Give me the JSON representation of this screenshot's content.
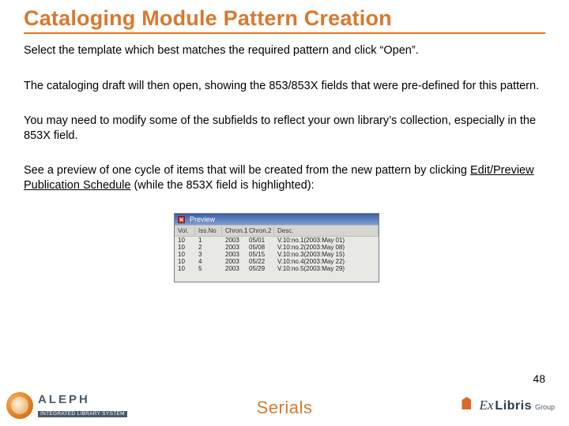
{
  "title": "Cataloging Module Pattern Creation",
  "paragraphs": {
    "p1": "Select the template which best matches the required pattern and click “Open”.",
    "p2": "The cataloging draft will then open, showing the 853/853X fields that were pre-defined for this pattern.",
    "p3": "You may need to modify some of the subfields to reflect your own library’s collection, especially in the 853X field.",
    "p4_a": "See a preview of one cycle of items that will be created from the new pattern by clicking ",
    "p4_link": "Edit/Preview Publication Schedule",
    "p4_b": " (while the 853X field is highlighted):"
  },
  "preview": {
    "title": "Preview",
    "cols": {
      "c1": "Vol.",
      "c2": "Iss.No",
      "c3": "Chron.1",
      "c4": "Chron.2",
      "c5": "Desc."
    },
    "rows": [
      {
        "c1": "10",
        "c2": "1",
        "c3": "2003",
        "c4": "05/01",
        "c5": "V.10:no.1(2003:May 01)"
      },
      {
        "c1": "10",
        "c2": "2",
        "c3": "2003",
        "c4": "05/08",
        "c5": "V.10:no.2(2003:May 08)"
      },
      {
        "c1": "10",
        "c2": "3",
        "c3": "2003",
        "c4": "05/15",
        "c5": "V.10:no.3(2003:May 15)"
      },
      {
        "c1": "10",
        "c2": "4",
        "c3": "2003",
        "c4": "05/22",
        "c5": "V.10:no.4(2003:May 22)"
      },
      {
        "c1": "10",
        "c2": "5",
        "c3": "2003",
        "c4": "05/29",
        "c5": "V.10:no.5(2003:May 29)"
      }
    ]
  },
  "page_number": "48",
  "footer": {
    "aleph_name": "ALEPH",
    "aleph_tag": "INTEGRATED LIBRARY SYSTEM",
    "center": "Serials",
    "exlibris_ex": "Ex",
    "exlibris_libris": "Libris",
    "exlibris_group": "Group"
  }
}
